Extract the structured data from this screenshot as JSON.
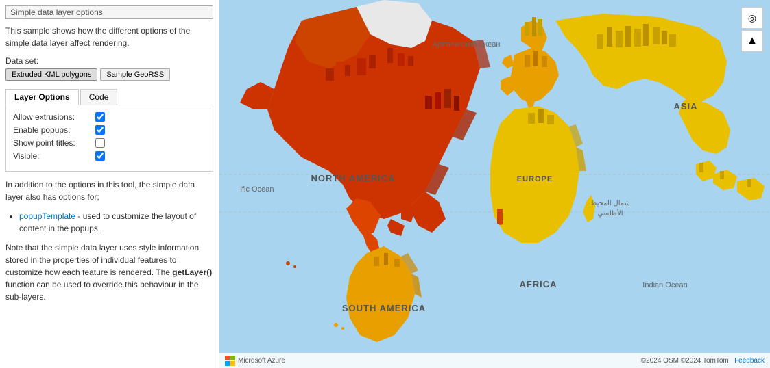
{
  "panel": {
    "section_title": "Simple data layer options",
    "description": "This sample shows how the different options of the simple data layer affect rendering.",
    "dataset_label": "Data set:",
    "dataset_options": [
      {
        "label": "Extruded KML polygons",
        "active": true
      },
      {
        "label": "Sample GeoRSS",
        "active": false
      }
    ],
    "tabs": [
      {
        "label": "Layer Options",
        "active": true
      },
      {
        "label": "Code",
        "active": false
      }
    ],
    "options": [
      {
        "label": "Allow extrusions:",
        "checked": true
      },
      {
        "label": "Enable popups:",
        "checked": true
      },
      {
        "label": "Show point titles:",
        "checked": false
      },
      {
        "label": "Visible:",
        "checked": true
      }
    ],
    "info_text": "In addition to the options in this tool, the simple data layer also has options for;",
    "bullet_items": [
      {
        "code": "popupTemplate",
        "text": " - used to customize the layout of content in the popups."
      }
    ],
    "note_text": "Note that the simple data layer uses style information stored in the properties of individual features to customize how each feature is rendered. The getLayer() function can be used to override this behaviour in the sub-layers."
  },
  "map": {
    "controls": [
      {
        "icon": "◎",
        "label": "compass-button"
      },
      {
        "icon": "▲",
        "label": "tilt-button"
      }
    ],
    "labels": {
      "arctic_ocean": "Арктический Океан",
      "north_america": "NORTH AMERICA",
      "europe": "EUROPE",
      "asia": "ASIA",
      "africa": "AFRICA",
      "south_america": "SOUTH AMERICA",
      "indian_ocean": "Indian Ocean",
      "atlantic_ocean": "ific Ocean",
      "arabic_label": "شمال المحيط الأطلسي"
    },
    "attribution": {
      "logo_text": "Microsoft Azure",
      "copy_text": "©2024 OSM ©2024 TomTom",
      "feedback": "Feedback"
    }
  }
}
